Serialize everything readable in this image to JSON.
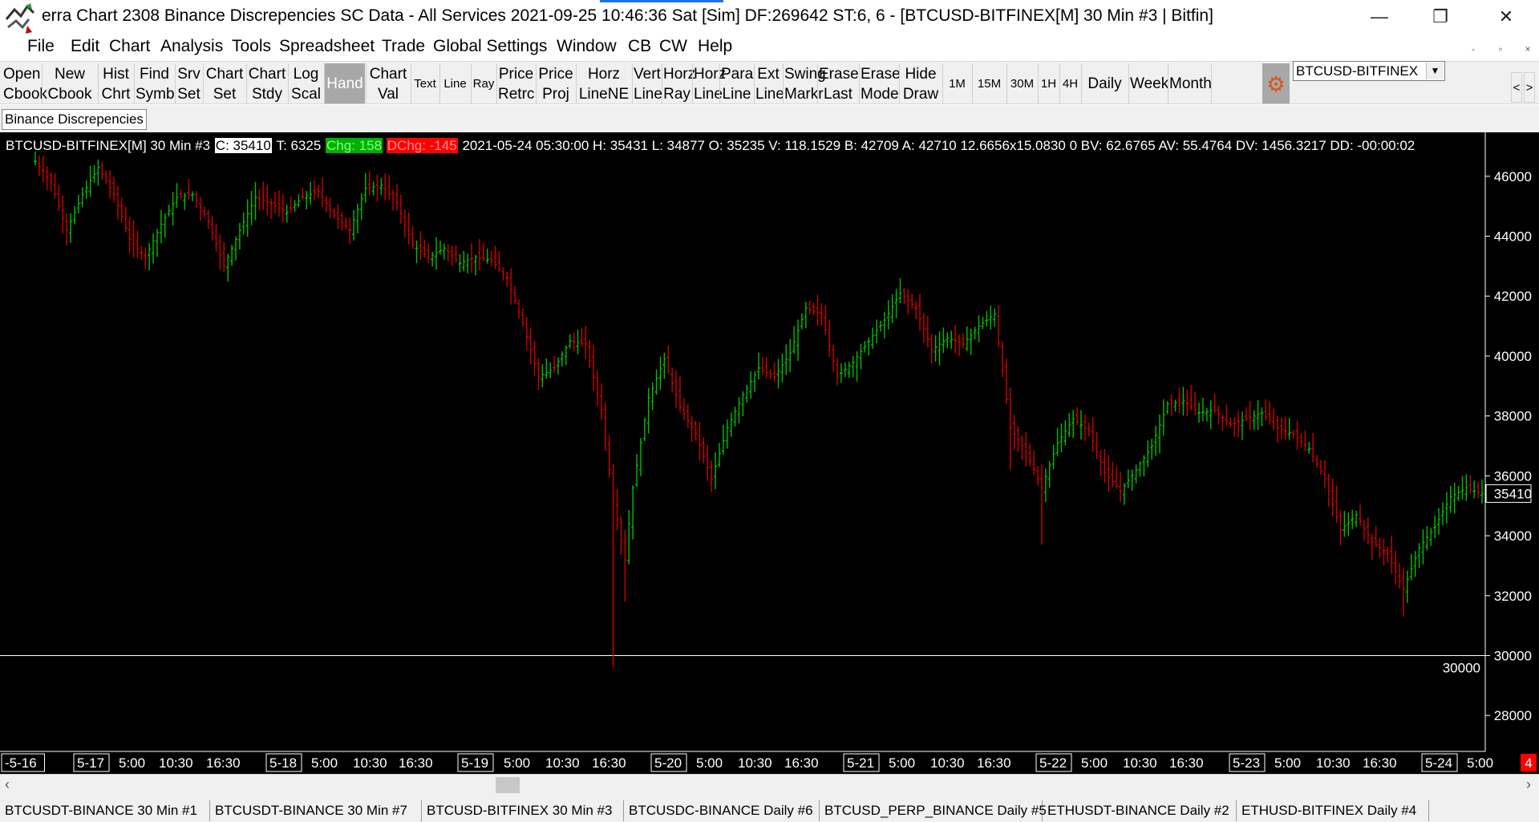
{
  "window": {
    "title": "erra Chart 2308 Binance Discrepencies  SC Data - All Services 2021-09-25  10:46:36 Sat [Sim]   DF:269642   ST:6, 6 - [BTCUSD-BITFINEX[M]  30 Min   #3 | Bitfin]",
    "minimize_icon": "minimize-icon",
    "maximize_icon": "restore-icon",
    "close_icon": "close-icon"
  },
  "menu": {
    "items": [
      "File",
      "Edit",
      "Chart",
      "Analysis",
      "Tools",
      "Spreadsheet",
      "Trade",
      "Global Settings",
      "Window",
      "CB",
      "CW",
      "Help"
    ],
    "mdi_buttons": [
      "-",
      "▫",
      "×"
    ]
  },
  "toolbar": {
    "buttons": [
      {
        "label": "Open\nCbook"
      },
      {
        "label": "New\nCbook"
      },
      {
        "label": "Hist\nChrt"
      },
      {
        "label": "Find\nSymb"
      },
      {
        "label": "Srv\nSet"
      },
      {
        "label": "Chart\nSet"
      },
      {
        "label": "Chart\nStdy"
      },
      {
        "label": "Log\nScal"
      },
      {
        "label": "Hand",
        "active": true
      },
      {
        "label": "Chart\nVal"
      },
      {
        "label": "Text"
      },
      {
        "label": "Line"
      },
      {
        "label": "Ray"
      },
      {
        "label": "Price\nRetrc"
      },
      {
        "label": "Price\nProj"
      },
      {
        "label": "Horz\nLineNE"
      },
      {
        "label": "Vert\nLine"
      },
      {
        "label": "Horz\nRay"
      },
      {
        "label": "Horz\nLine"
      },
      {
        "label": "Para\nLine"
      },
      {
        "label": "Ext\nLine"
      },
      {
        "label": "Swing\nMarkr"
      },
      {
        "label": "Erase\nLast"
      },
      {
        "label": "Erase\nMode"
      },
      {
        "label": "Hide\nDraw"
      },
      {
        "label": "1M"
      },
      {
        "label": "15M"
      },
      {
        "label": "30M"
      },
      {
        "label": "1H"
      },
      {
        "label": "4H"
      },
      {
        "label": "Daily"
      },
      {
        "label": "Week"
      },
      {
        "label": "Month"
      }
    ],
    "settings_icon": "gear-icon",
    "symbol_value": "BTCUSD-BITFINEX",
    "nav_left": "<",
    "nav_right": ">"
  },
  "chartbook": {
    "tab_label": "Binance Discrepencies"
  },
  "chart": {
    "info": {
      "symbol": "BTCUSD-BITFINEX[M]  30 Min   #3",
      "close": "C: 35410",
      "trades": "T: 6325",
      "chg": "Chg: 158",
      "dchg": "DChg: -145",
      "details": "2021-05-24 05:30:00 H: 35431 L: 34877 O: 35235 V: 118.1529 B: 42709 A: 42710 12.6656x15.0830 0 BV: 62.6765 AV: 55.4764 DV: 1456.3217 DD: -00:00:02"
    },
    "colors": {
      "background": "#000000",
      "up": "#00c000",
      "down": "#d00000",
      "axis": "#ffffff"
    },
    "last_price_label": "35410",
    "ref_line_value": 30000,
    "ref_line_label": "30000",
    "corner_badge": "4",
    "time_axis": {
      "labels": [
        {
          "text": "-5-16",
          "boxed": true
        },
        {
          "text": "5-17",
          "boxed": true
        },
        {
          "text": "5:00"
        },
        {
          "text": "10:30"
        },
        {
          "text": "16:30"
        },
        {
          "text": "5-18",
          "boxed": true
        },
        {
          "text": "5:00"
        },
        {
          "text": "10:30"
        },
        {
          "text": "16:30"
        },
        {
          "text": "5-19",
          "boxed": true
        },
        {
          "text": "5:00"
        },
        {
          "text": "10:30"
        },
        {
          "text": "16:30"
        },
        {
          "text": "5-20",
          "boxed": true
        },
        {
          "text": "5:00"
        },
        {
          "text": "10:30"
        },
        {
          "text": "16:30"
        },
        {
          "text": "5-21",
          "boxed": true
        },
        {
          "text": "5:00"
        },
        {
          "text": "10:30"
        },
        {
          "text": "16:30"
        },
        {
          "text": "5-22",
          "boxed": true
        },
        {
          "text": "5:00"
        },
        {
          "text": "10:30"
        },
        {
          "text": "16:30"
        },
        {
          "text": "5-23",
          "boxed": true
        },
        {
          "text": "5:00"
        },
        {
          "text": "10:30"
        },
        {
          "text": "16:30"
        },
        {
          "text": "5-24",
          "boxed": true
        },
        {
          "text": "5:00"
        }
      ]
    }
  },
  "chart_data": {
    "type": "candlestick",
    "series": [
      {
        "name": "BTCUSD-BITFINEX[M]",
        "interval": "30 Min"
      }
    ],
    "ylim": [
      26800,
      47200
    ],
    "yticks": [
      28000,
      30000,
      32000,
      34000,
      36000,
      38000,
      40000,
      42000,
      44000,
      46000
    ],
    "x": [
      "5-16",
      "5-17",
      "5-18",
      "5-19",
      "5-20",
      "5-21",
      "5-22",
      "5-23",
      "5-24"
    ],
    "close_path": [
      [
        0,
        46500
      ],
      [
        4,
        45800
      ],
      [
        8,
        44200
      ],
      [
        12,
        45400
      ],
      [
        16,
        46300
      ],
      [
        20,
        45400
      ],
      [
        24,
        43900
      ],
      [
        28,
        43300
      ],
      [
        32,
        44400
      ],
      [
        36,
        45300
      ],
      [
        40,
        45400
      ],
      [
        44,
        44500
      ],
      [
        48,
        43000
      ],
      [
        52,
        44200
      ],
      [
        56,
        45300
      ],
      [
        60,
        45100
      ],
      [
        64,
        44800
      ],
      [
        68,
        45300
      ],
      [
        72,
        45500
      ],
      [
        76,
        44700
      ],
      [
        80,
        44200
      ],
      [
        84,
        45600
      ],
      [
        88,
        45700
      ],
      [
        92,
        45100
      ],
      [
        96,
        43700
      ],
      [
        100,
        43300
      ],
      [
        104,
        43600
      ],
      [
        108,
        43100
      ],
      [
        112,
        43300
      ],
      [
        116,
        43200
      ],
      [
        120,
        42600
      ],
      [
        124,
        41100
      ],
      [
        128,
        39300
      ],
      [
        132,
        39600
      ],
      [
        136,
        40500
      ],
      [
        140,
        40400
      ],
      [
        144,
        38200
      ],
      [
        147,
        35200
      ],
      [
        150,
        33200
      ],
      [
        152,
        35600
      ],
      [
        156,
        38600
      ],
      [
        160,
        39900
      ],
      [
        164,
        38300
      ],
      [
        168,
        37400
      ],
      [
        172,
        35900
      ],
      [
        176,
        37600
      ],
      [
        180,
        38700
      ],
      [
        184,
        39600
      ],
      [
        188,
        39300
      ],
      [
        192,
        40100
      ],
      [
        196,
        41600
      ],
      [
        200,
        41400
      ],
      [
        204,
        39300
      ],
      [
        208,
        39800
      ],
      [
        212,
        40500
      ],
      [
        216,
        41200
      ],
      [
        220,
        42100
      ],
      [
        224,
        41600
      ],
      [
        228,
        40200
      ],
      [
        232,
        40600
      ],
      [
        236,
        40400
      ],
      [
        240,
        41000
      ],
      [
        244,
        41400
      ],
      [
        248,
        37600
      ],
      [
        252,
        36800
      ],
      [
        256,
        35600
      ],
      [
        260,
        37100
      ],
      [
        264,
        37900
      ],
      [
        268,
        37500
      ],
      [
        272,
        36100
      ],
      [
        276,
        35500
      ],
      [
        280,
        36200
      ],
      [
        284,
        37000
      ],
      [
        288,
        38400
      ],
      [
        292,
        38500
      ],
      [
        296,
        38100
      ],
      [
        300,
        38200
      ],
      [
        304,
        37700
      ],
      [
        308,
        37900
      ],
      [
        312,
        38100
      ],
      [
        316,
        37600
      ],
      [
        320,
        37400
      ],
      [
        324,
        36900
      ],
      [
        328,
        35900
      ],
      [
        332,
        34200
      ],
      [
        336,
        34700
      ],
      [
        340,
        33800
      ],
      [
        344,
        33400
      ],
      [
        348,
        32200
      ],
      [
        352,
        33600
      ],
      [
        356,
        34300
      ],
      [
        360,
        35300
      ],
      [
        364,
        35600
      ],
      [
        368,
        35410
      ]
    ]
  },
  "scrollbar": {
    "left": "‹",
    "right": "›"
  },
  "bottom_tabs": [
    "BTCUSDT-BINANCE  30 Min   #1",
    "BTCUSDT-BINANCE  30 Min   #7",
    "BTCUSD-BITFINEX  30 Min   #3",
    "BTCUSDC-BINANCE  Daily   #6",
    "BTCUSD_PERP_BINANCE  Daily   #5",
    "ETHUSDT-BINANCE  Daily   #2",
    "ETHUSD-BITFINEX  Daily   #4"
  ]
}
